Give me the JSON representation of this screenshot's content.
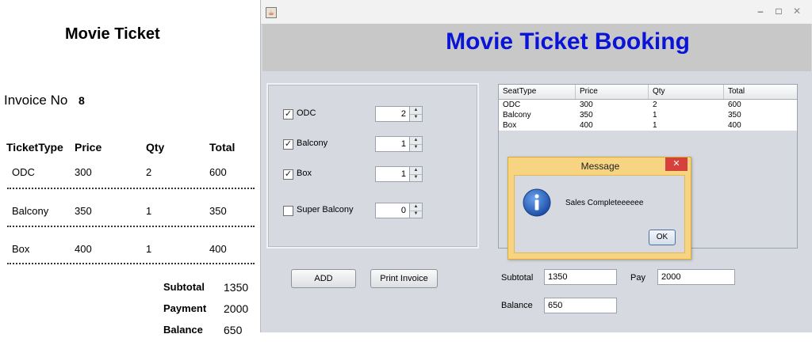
{
  "invoice": {
    "title": "Movie Ticket",
    "invoice_no_label": "Invoice No",
    "invoice_no": "8",
    "headers": [
      "TicketType",
      "Price",
      "Qty",
      "Total"
    ],
    "rows": [
      [
        "ODC",
        "300",
        "2",
        "600"
      ],
      [
        "Balcony",
        "350",
        "1",
        "350"
      ],
      [
        "Box",
        "400",
        "1",
        "400"
      ]
    ],
    "subtotal_label": "Subtotal",
    "subtotal": "1350",
    "payment_label": "Payment",
    "payment": "2000",
    "balance_label": "Balance",
    "balance": "650"
  },
  "window": {
    "title": "Movie Ticket Booking",
    "controls": {
      "minimize": "–",
      "maximize": "□",
      "close": "✕"
    }
  },
  "seats": [
    {
      "label": "ODC",
      "checked": true,
      "qty": "2"
    },
    {
      "label": "Balcony",
      "checked": true,
      "qty": "1"
    },
    {
      "label": "Box",
      "checked": true,
      "qty": "1"
    },
    {
      "label": "Super Balcony",
      "checked": false,
      "qty": "0"
    }
  ],
  "buttons": {
    "add": "ADD",
    "print": "Print Invoice"
  },
  "table": {
    "headers": [
      "SeatType",
      "Price",
      "Qty",
      "Total"
    ],
    "rows": [
      [
        "ODC",
        "300",
        "2",
        "600"
      ],
      [
        "Balcony",
        "350",
        "1",
        "350"
      ],
      [
        "Box",
        "400",
        "1",
        "400"
      ]
    ]
  },
  "fields": {
    "subtotal_label": "Subtotal",
    "subtotal": "1350",
    "pay_label": "Pay",
    "pay": "2000",
    "balance_label": "Balance",
    "balance": "650"
  },
  "dialog": {
    "title": "Message",
    "message": "Sales Completeeeeee",
    "ok": "OK",
    "icon": "info-icon",
    "accent": "#f7d482"
  },
  "colors": {
    "title": "#0a14d6",
    "dialog_close": "#d6423b"
  }
}
